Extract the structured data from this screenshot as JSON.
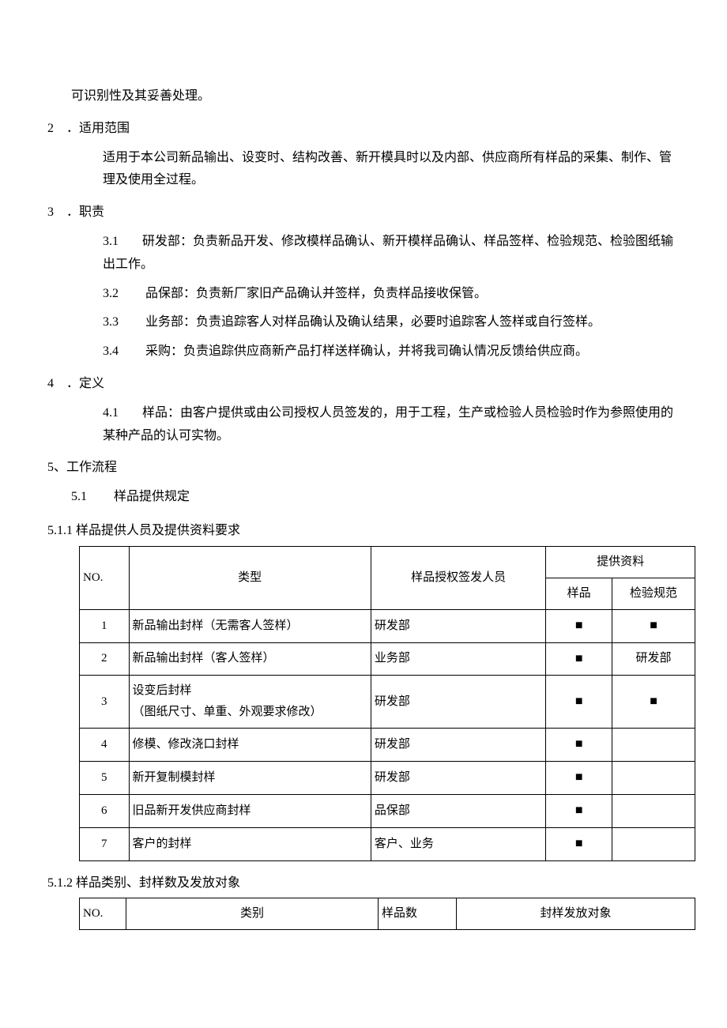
{
  "sections": {
    "s1_tail": "可识别性及其妥善处理。",
    "s2_title": "．适用范围",
    "s2_num": "2",
    "s2_body": "适用于本公司新品输出、设变时、结构改善、新开模具时以及内部、供应商所有样品的采集、制作、管理及使用全过程。",
    "s3_num": "3",
    "s3_title": "．职责",
    "s3_1_num": "3.1",
    "s3_1": "研发部：负责新品开发、修改模样品确认、新开模样品确认、样品签样、检验规范、检验图纸输出工作。",
    "s3_2_num": "3.2",
    "s3_2": " 品保部：负责新厂家旧产品确认并签样，负责样品接收保管。",
    "s3_3_num": "3.3",
    "s3_3": " 业务部：负责追踪客人对样品确认及确认结果，必要时追踪客人签样或自行签样。",
    "s3_4_num": "3.4",
    "s3_4": " 采购：负责追踪供应商新产品打样送样确认，并将我司确认情况反馈给供应商。",
    "s4_num": "4",
    "s4_title": "．定义",
    "s4_1_num": "4.1",
    "s4_1": "样品：由客户提供或由公司授权人员签发的，用于工程，生产或检验人员检验时作为参照使用的某种产品的认可实物。",
    "s5_num": "5、",
    "s5_title": "工作流程",
    "s5_1_num": "5.1",
    "s5_1": "  样品提供规定"
  },
  "table1": {
    "caption_num": "5.1.1",
    "caption": "样品提供人员及提供资料要求",
    "headers": {
      "no": "NO.",
      "type": "类型",
      "signer": "样品授权签发人员",
      "materials": "提供资料",
      "sample": "样品",
      "spec": "检验规范"
    },
    "rows": [
      {
        "no": "1",
        "type": "新品输出封样（无需客人签样）",
        "signer": "研发部",
        "sample": "■",
        "spec": "■"
      },
      {
        "no": "2",
        "type": "新品输出封样（客人签样）",
        "signer": "业务部",
        "sample": "■",
        "spec": "研发部"
      },
      {
        "no": "3",
        "type": "设变后封样\n（图纸尺寸、单重、外观要求修改）",
        "signer": "研发部",
        "sample": "■",
        "spec": "■"
      },
      {
        "no": "4",
        "type": "修模、修改浇口封样",
        "signer": "研发部",
        "sample": "■",
        "spec": ""
      },
      {
        "no": "5",
        "type": "新开复制模封样",
        "signer": "研发部",
        "sample": "■",
        "spec": ""
      },
      {
        "no": "6",
        "type": "旧品新开发供应商封样",
        "signer": "品保部",
        "sample": "■",
        "spec": ""
      },
      {
        "no": "7",
        "type": "客户的封样",
        "signer": "客户、业务",
        "sample": "■",
        "spec": ""
      }
    ]
  },
  "table2": {
    "caption_num": "5.1.2",
    "caption": "样品类别、封样数及发放对象",
    "headers": {
      "no": "NO.",
      "category": "类别",
      "count": "样品数",
      "target": "封样发放对象"
    }
  }
}
